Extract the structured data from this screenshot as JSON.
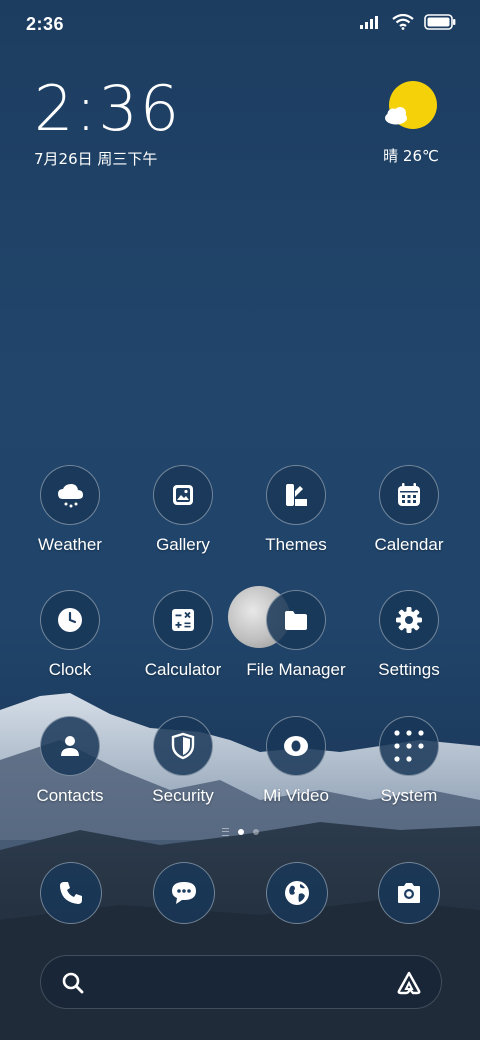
{
  "status_bar": {
    "time": "2:36",
    "battery_level": 1.0
  },
  "clock": {
    "time": "2:36",
    "date": "7月26日 周三下午"
  },
  "weather": {
    "text": "晴 26℃",
    "icon": "sun-cloud-icon"
  },
  "apps": [
    {
      "label": "Weather",
      "icon": "cloud-snow-icon"
    },
    {
      "label": "Gallery",
      "icon": "image-icon"
    },
    {
      "label": "Themes",
      "icon": "palette-icon"
    },
    {
      "label": "Calendar",
      "icon": "calendar-icon"
    },
    {
      "label": "Clock",
      "icon": "clock-icon"
    },
    {
      "label": "Calculator",
      "icon": "calculator-icon"
    },
    {
      "label": "File Manager",
      "icon": "folder-icon"
    },
    {
      "label": "Settings",
      "icon": "gear-icon"
    },
    {
      "label": "Contacts",
      "icon": "person-icon"
    },
    {
      "label": "Security",
      "icon": "shield-icon"
    },
    {
      "label": "Mi Video",
      "icon": "play-icon"
    },
    {
      "label": "System",
      "icon": "folder-grid-icon"
    }
  ],
  "dock": [
    {
      "icon": "phone-icon"
    },
    {
      "icon": "message-icon"
    },
    {
      "icon": "globe-icon"
    },
    {
      "icon": "camera-icon"
    }
  ],
  "page_indicator": {
    "pages": 2,
    "current": 1
  },
  "search": {
    "icon": "search-icon",
    "assistant_icon": "assistant-icon"
  },
  "colors": {
    "background": "#21456b",
    "icon_bg": "#193758",
    "weather_sun": "#f5d10a"
  }
}
